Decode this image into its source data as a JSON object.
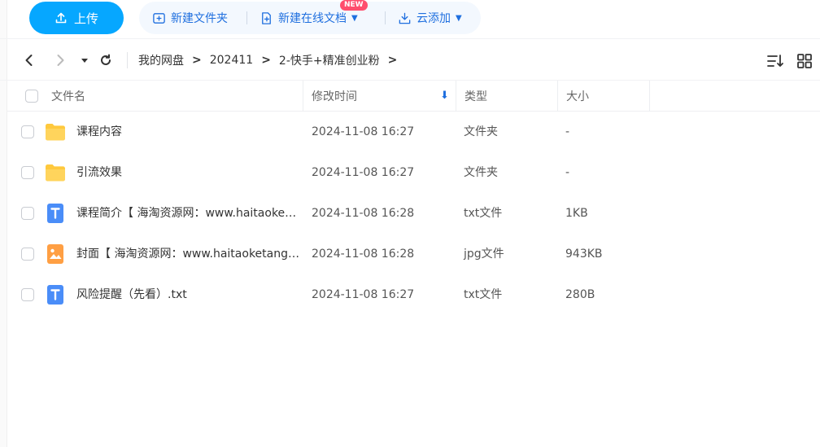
{
  "toolbar": {
    "upload_label": "上传",
    "new_folder_label": "新建文件夹",
    "new_online_doc_label": "新建在线文档",
    "new_badge": "NEW",
    "cloud_add_label": "云添加"
  },
  "nav": {
    "breadcrumb": [
      "我的网盘",
      "202411",
      "2-快手+精准创业粉"
    ]
  },
  "table": {
    "headers": {
      "name": "文件名",
      "modified": "修改时间",
      "type": "类型",
      "size": "大小"
    },
    "rows": [
      {
        "name": "课程内容",
        "date": "2024-11-08 16:27",
        "type": "文件夹",
        "size": "-",
        "icon": "folder-icon"
      },
      {
        "name": "引流效果",
        "date": "2024-11-08 16:27",
        "type": "文件夹",
        "size": "-",
        "icon": "folder-icon"
      },
      {
        "name": "课程简介【 海淘资源网：www.haitaoketang.com】.txt",
        "date": "2024-11-08 16:28",
        "type": "txt文件",
        "size": "1KB",
        "icon": "txt-file-icon"
      },
      {
        "name": "封面【 海淘资源网：www.haitaoketang.com】.jpg",
        "date": "2024-11-08 16:28",
        "type": "jpg文件",
        "size": "943KB",
        "icon": "image-file-icon"
      },
      {
        "name": "风险提醒（先看）.txt",
        "date": "2024-11-08 16:27",
        "type": "txt文件",
        "size": "280B",
        "icon": "txt-file-icon"
      }
    ]
  },
  "colors": {
    "accent": "#06a7ff",
    "link": "#1f6fdf",
    "folder": "#ffc93d",
    "txt": "#4a8df8",
    "image": "#ff9f43"
  }
}
